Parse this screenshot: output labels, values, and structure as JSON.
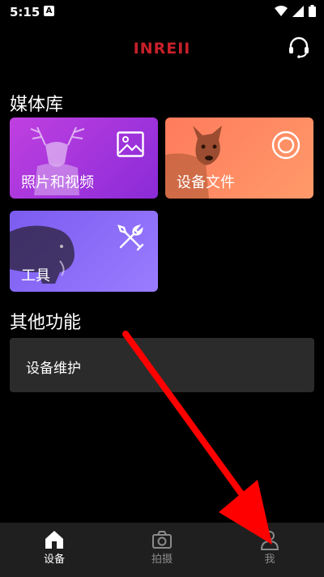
{
  "status": {
    "time": "5:15",
    "notif": "A"
  },
  "header": {
    "brand": "INREII"
  },
  "sections": {
    "media_title": "媒体库",
    "other_title": "其他功能"
  },
  "cards": {
    "photos_label": "照片和视频",
    "files_label": "设备文件",
    "tools_label": "工具"
  },
  "other": {
    "maintenance_label": "设备维护"
  },
  "nav": {
    "device_label": "设备",
    "capture_label": "拍摄",
    "me_label": "我"
  },
  "colors": {
    "accent_red": "#ff0000",
    "brand_red": "#c8202a",
    "card_purple": "#b43ee6",
    "card_orange": "#ff8a60",
    "card_violet": "#8a6cf5"
  }
}
